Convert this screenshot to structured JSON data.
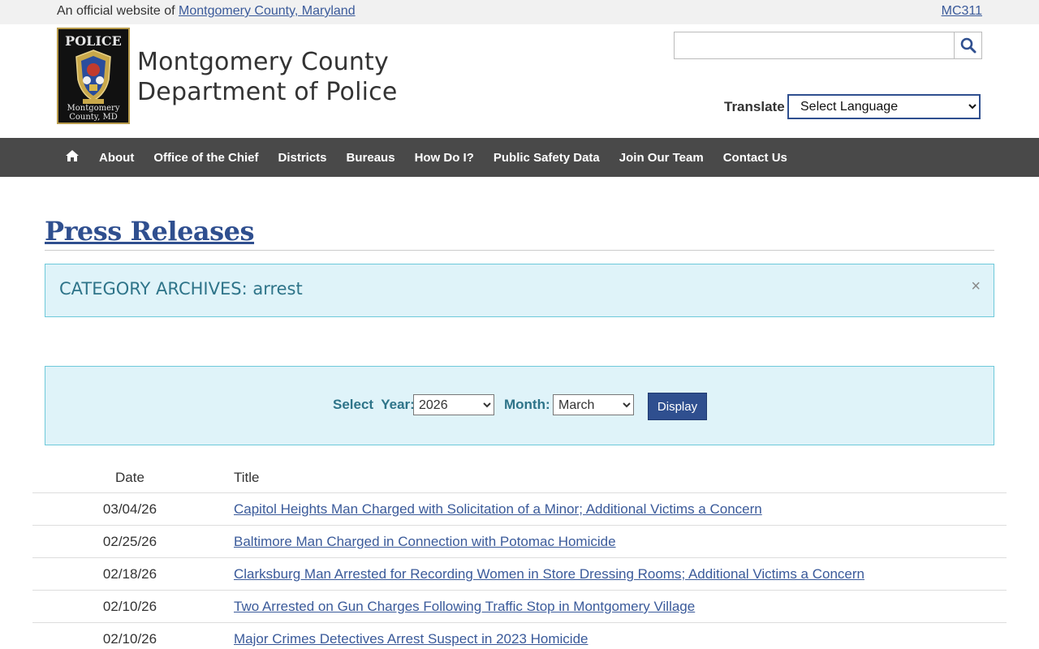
{
  "topbar": {
    "official_prefix": "An official website of",
    "official_link": "Montgomery County, Maryland",
    "mc311": "MC311"
  },
  "header": {
    "logo_icon": "police-badge-icon",
    "logo_top_text": "POLICE",
    "logo_bottom_line1": "Montgomery",
    "logo_bottom_line2": "County, MD",
    "title_line1": "Montgomery County",
    "title_line2": "Department of Police",
    "search_placeholder": "",
    "search_icon": "search-icon",
    "translate_label": "Translate",
    "language_selected": "Select Language"
  },
  "nav": {
    "home_icon": "home-icon",
    "items": [
      {
        "label": "About"
      },
      {
        "label": "Office of the Chief"
      },
      {
        "label": "Districts"
      },
      {
        "label": "Bureaus"
      },
      {
        "label": "How Do I?"
      },
      {
        "label": "Public Safety Data"
      },
      {
        "label": "Join Our Team"
      },
      {
        "label": "Contact Us"
      }
    ]
  },
  "main": {
    "page_title": "Press Releases",
    "alert_text": "CATEGORY ARCHIVES: arrest",
    "alert_close": "×",
    "filter": {
      "select_label": "Select  Year:",
      "year_selected": "2026",
      "month_label": "Month:",
      "month_selected": "March",
      "display_label": "Display"
    },
    "table": {
      "headers": {
        "date": "Date",
        "title": "Title"
      },
      "rows": [
        {
          "date": "03/04/26",
          "title": "Capitol Heights Man Charged with Solicitation of a Minor; Additional Victims a Concern"
        },
        {
          "date": "02/25/26",
          "title": "Baltimore Man Charged in Connection with Potomac Homicide"
        },
        {
          "date": "02/18/26",
          "title": "Clarksburg Man Arrested for Recording Women in Store Dressing Rooms; Additional Victims a Concern"
        },
        {
          "date": "02/10/26",
          "title": "Two Arrested on Gun Charges Following Traffic Stop in Montgomery Village"
        },
        {
          "date": "02/10/26",
          "title": "Major Crimes Detectives Arrest Suspect in 2023 Homicide"
        }
      ]
    }
  }
}
